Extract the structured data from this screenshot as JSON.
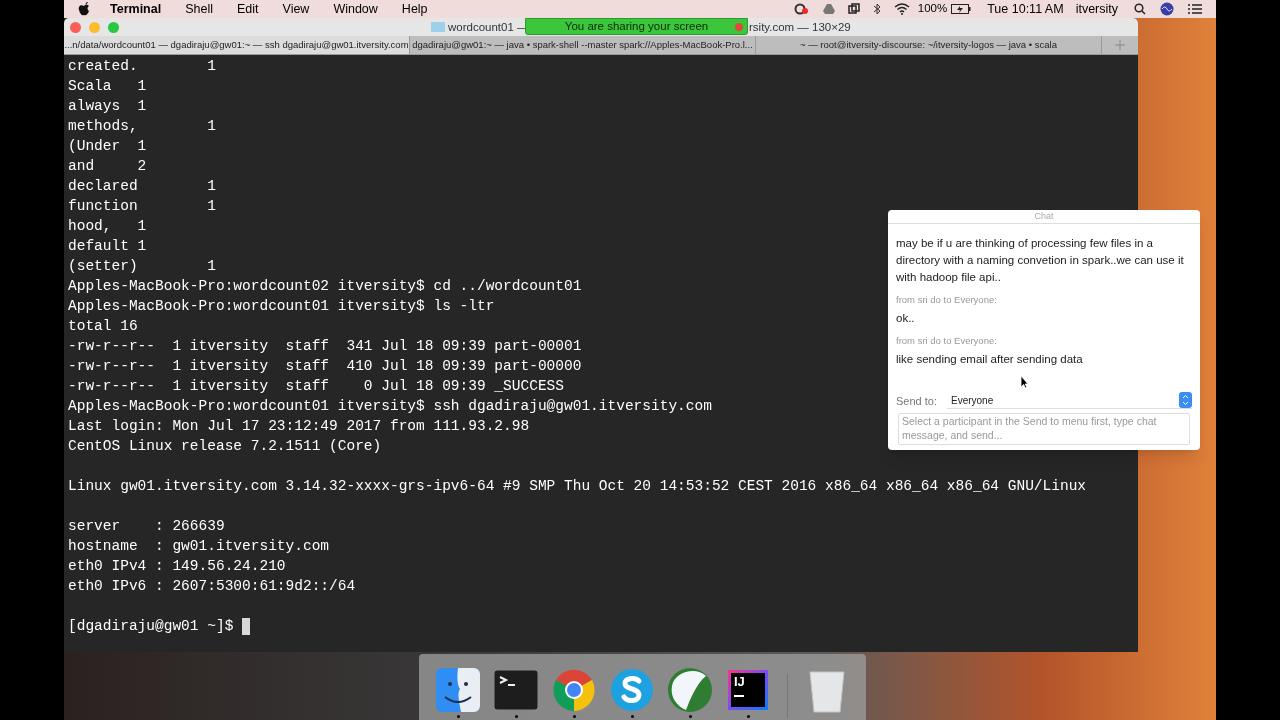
{
  "menu_bar": {
    "app": "Terminal",
    "menus": [
      "Shell",
      "Edit",
      "View",
      "Window",
      "Help"
    ],
    "battery": "100%",
    "clock": "Tue 10:11 AM",
    "user": "itversity"
  },
  "terminal": {
    "title_left": "wordcount01 —",
    "title_right": "rsity.com — 130×29",
    "sharing_banner": "You are sharing your screen",
    "tabs": [
      {
        "label": "...n/data/wordcount01 — dgadiraju@gw01:~ — ssh dgadiraju@gw01.itversity.com",
        "selected": true
      },
      {
        "label": "dgadiraju@gw01:~ — java • spark-shell --master spark://Apples-MacBook-Pro.l...",
        "selected": false
      },
      {
        "label": "~ — root@itversity-discourse: ~/itversity-logos — java • scala",
        "selected": false
      }
    ],
    "blocks": [
      {
        "lines": [
          {
            "text": "created.        1",
            "cursor": false
          },
          {
            "text": "Scala   1",
            "cursor": false
          },
          {
            "text": "always  1",
            "cursor": false
          },
          {
            "text": "methods,        1",
            "cursor": false
          },
          {
            "text": "(Under  1",
            "cursor": false
          },
          {
            "text": "and     2",
            "cursor": false
          },
          {
            "text": "declared        1",
            "cursor": false
          },
          {
            "text": "function        1",
            "cursor": false
          },
          {
            "text": "hood,   1",
            "cursor": false
          },
          {
            "text": "default 1",
            "cursor": false
          },
          {
            "text": "(setter)        1",
            "cursor": false
          },
          {
            "text": "Apples-MacBook-Pro:wordcount02 itversity$ cd ../wordcount01",
            "cursor": false
          },
          {
            "text": "Apples-MacBook-Pro:wordcount01 itversity$ ls -ltr",
            "cursor": false
          },
          {
            "text": "total 16",
            "cursor": false
          },
          {
            "text": "-rw-r--r--  1 itversity  staff  341 Jul 18 09:39 part-00001",
            "cursor": false
          },
          {
            "text": "-rw-r--r--  1 itversity  staff  410 Jul 18 09:39 part-00000",
            "cursor": false
          },
          {
            "text": "-rw-r--r--  1 itversity  staff    0 Jul 18 09:39 _SUCCESS",
            "cursor": false
          },
          {
            "text": "Apples-MacBook-Pro:wordcount01 itversity$ ssh dgadiraju@gw01.itversity.com",
            "cursor": false
          },
          {
            "text": "Last login: Mon Jul 17 23:12:49 2017 from 111.93.2.98",
            "cursor": false
          },
          {
            "text": "CentOS Linux release 7.2.1511 (Core)",
            "cursor": false
          }
        ]
      },
      {
        "lines": [
          {
            "text": "Linux gw01.itversity.com 3.14.32-xxxx-grs-ipv6-64 #9 SMP Thu Oct 20 14:53:52 CEST 2016 x86_64 x86_64 x86_64 GNU/Linux",
            "cursor": false
          }
        ]
      },
      {
        "lines": [
          {
            "text": "server    : 266639",
            "cursor": false
          },
          {
            "text": "hostname  : gw01.itversity.com",
            "cursor": false
          },
          {
            "text": "eth0 IPv4 : 149.56.24.210",
            "cursor": false
          },
          {
            "text": "eth0 IPv6 : 2607:5300:61:9d2::/64",
            "cursor": false
          }
        ]
      },
      {
        "lines": [
          {
            "text": "[dgadiraju@gw01 ~]$ ",
            "cursor": true
          }
        ]
      }
    ]
  },
  "chat": {
    "title": "Chat",
    "messages": [
      {
        "text": "may be if u are thinking of processing few files in a directory with a naming convetion in spark..we can use it with hadoop file api.."
      },
      {
        "sender": "from sri do to Everyone:",
        "text": "ok.."
      },
      {
        "sender": "from sri do to Everyone:",
        "text": "like sending email after sending data"
      }
    ],
    "send_to_label": "Send to:",
    "send_to_value": "Everyone",
    "placeholder": "Select a participant in the Send to menu first, type chat message, and send..."
  },
  "dock": [
    {
      "kind": "finder",
      "running": true
    },
    {
      "kind": "terminal",
      "running": true
    },
    {
      "kind": "chrome",
      "running": true
    },
    {
      "kind": "skype",
      "running": true
    },
    {
      "kind": "webex",
      "running": true
    },
    {
      "kind": "intellij",
      "label": "IJ",
      "running": true
    },
    {
      "kind": "separator"
    },
    {
      "kind": "trash",
      "running": false
    }
  ]
}
